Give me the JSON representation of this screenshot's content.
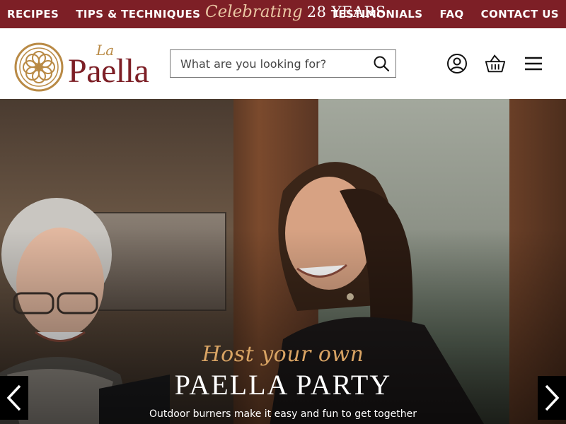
{
  "topbar": {
    "nav_left": [
      "RECIPES",
      "TIPS & TECHNIQUES"
    ],
    "celebrate_script": "Celebrating",
    "celebrate_years": "28 YEARS",
    "nav_right": [
      "TESTIMONIALS",
      "FAQ",
      "CONTACT US"
    ],
    "bg_color": "#7d1f26"
  },
  "header": {
    "logo_small": "La",
    "logo_main": "Paella",
    "search_placeholder": "What are you looking for?",
    "icons": [
      "account-icon",
      "basket-icon",
      "menu-icon"
    ]
  },
  "hero": {
    "script": "Host your own",
    "title": "PAELLA PARTY",
    "subtitle": "Outdoor burners make it easy and fun to get together",
    "prev_icon": "chevron-left-icon",
    "next_icon": "chevron-right-icon"
  }
}
